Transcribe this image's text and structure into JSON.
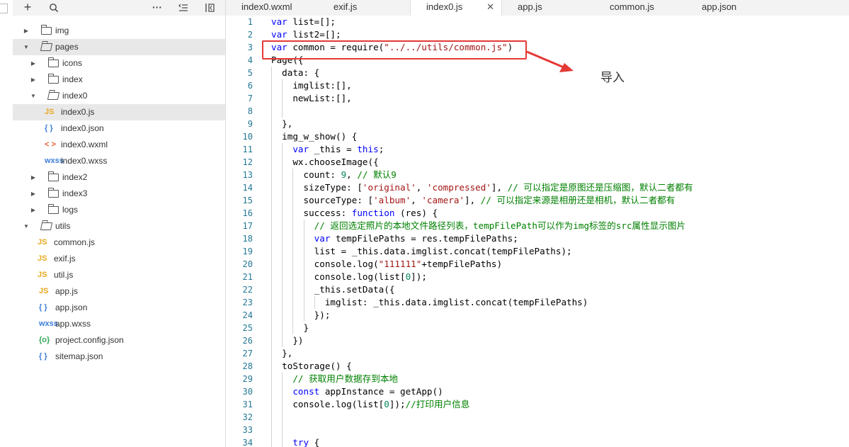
{
  "toolbar": {
    "icons": [
      "plus-icon",
      "search-icon",
      "more-icon",
      "collapse-icon",
      "split-icon"
    ]
  },
  "tabs": [
    {
      "label": "index0.wxml",
      "active": false
    },
    {
      "label": "exif.js",
      "active": false
    },
    {
      "label": "index0.js",
      "active": true
    },
    {
      "label": "app.js",
      "active": false
    },
    {
      "label": "common.js",
      "active": false
    },
    {
      "label": "app.json",
      "active": false
    }
  ],
  "tree": [
    {
      "label": "img",
      "type": "folder",
      "depth": 0,
      "expanded": false
    },
    {
      "label": "pages",
      "type": "folder",
      "depth": 0,
      "expanded": true,
      "hover": true
    },
    {
      "label": "icons",
      "type": "folder",
      "depth": 1,
      "expanded": false
    },
    {
      "label": "index",
      "type": "folder",
      "depth": 1,
      "expanded": false
    },
    {
      "label": "index0",
      "type": "folder",
      "depth": 1,
      "expanded": true
    },
    {
      "label": "index0.js",
      "type": "js",
      "depth": 2,
      "selected": true
    },
    {
      "label": "index0.json",
      "type": "json",
      "depth": 2
    },
    {
      "label": "index0.wxml",
      "type": "wxml",
      "depth": 2
    },
    {
      "label": "index0.wxss",
      "type": "wxss",
      "depth": 2
    },
    {
      "label": "index2",
      "type": "folder",
      "depth": 1,
      "expanded": false
    },
    {
      "label": "index3",
      "type": "folder",
      "depth": 1,
      "expanded": false
    },
    {
      "label": "logs",
      "type": "folder",
      "depth": 1,
      "expanded": false
    },
    {
      "label": "utils",
      "type": "folder",
      "depth": 0,
      "expanded": true
    },
    {
      "label": "common.js",
      "type": "js",
      "depth": 1
    },
    {
      "label": "exif.js",
      "type": "js",
      "depth": 1
    },
    {
      "label": "util.js",
      "type": "js",
      "depth": 1
    },
    {
      "label": "app.js",
      "type": "js",
      "depth": 0
    },
    {
      "label": "app.json",
      "type": "json",
      "depth": 0
    },
    {
      "label": "app.wxss",
      "type": "wxss",
      "depth": 0
    },
    {
      "label": "project.config.json",
      "type": "config",
      "depth": 0
    },
    {
      "label": "sitemap.json",
      "type": "json",
      "depth": 0
    }
  ],
  "icon_glyphs": {
    "js": "JS",
    "json": "{ }",
    "wxml": "< >",
    "wxss": "wxss",
    "config": "{o}"
  },
  "tab_close_glyph": "✕",
  "code": [
    {
      "n": "1",
      "indent": 0,
      "tokens": [
        [
          "k",
          "var"
        ],
        [
          "p",
          " list=[];"
        ]
      ]
    },
    {
      "n": "2",
      "indent": 0,
      "tokens": [
        [
          "k",
          "var"
        ],
        [
          "p",
          " list2=[];"
        ]
      ]
    },
    {
      "n": "3",
      "indent": 0,
      "tokens": [
        [
          "k",
          "var"
        ],
        [
          "p",
          " common = require("
        ],
        [
          "s",
          "\"../../utils/common.js\""
        ],
        [
          "p",
          ")"
        ]
      ]
    },
    {
      "n": "4",
      "indent": 0,
      "tokens": [
        [
          "p",
          "Page({"
        ]
      ]
    },
    {
      "n": "5",
      "indent": 1,
      "tokens": [
        [
          "p",
          "data: {"
        ]
      ]
    },
    {
      "n": "6",
      "indent": 2,
      "tokens": [
        [
          "p",
          "imglist:[],"
        ]
      ]
    },
    {
      "n": "7",
      "indent": 2,
      "tokens": [
        [
          "p",
          "newList:[],"
        ]
      ]
    },
    {
      "n": "8",
      "indent": 2,
      "tokens": []
    },
    {
      "n": "9",
      "indent": 1,
      "tokens": [
        [
          "p",
          "},"
        ]
      ]
    },
    {
      "n": "10",
      "indent": 1,
      "tokens": [
        [
          "p",
          "img_w_show() {"
        ]
      ]
    },
    {
      "n": "11",
      "indent": 2,
      "tokens": [
        [
          "k",
          "var"
        ],
        [
          "p",
          " _this = "
        ],
        [
          "k",
          "this"
        ],
        [
          "p",
          ";"
        ]
      ]
    },
    {
      "n": "12",
      "indent": 2,
      "tokens": [
        [
          "p",
          "wx.chooseImage({"
        ]
      ]
    },
    {
      "n": "13",
      "indent": 3,
      "tokens": [
        [
          "p",
          "count: "
        ],
        [
          "n",
          "9"
        ],
        [
          "p",
          ", "
        ],
        [
          "c",
          "// 默认9"
        ]
      ]
    },
    {
      "n": "14",
      "indent": 3,
      "tokens": [
        [
          "p",
          "sizeType: ["
        ],
        [
          "s",
          "'original'"
        ],
        [
          "p",
          ", "
        ],
        [
          "s",
          "'compressed'"
        ],
        [
          "p",
          "], "
        ],
        [
          "c",
          "// 可以指定是原图还是压缩图，默认二者都有"
        ]
      ]
    },
    {
      "n": "15",
      "indent": 3,
      "tokens": [
        [
          "p",
          "sourceType: ["
        ],
        [
          "s",
          "'album'"
        ],
        [
          "p",
          ", "
        ],
        [
          "s",
          "'camera'"
        ],
        [
          "p",
          "], "
        ],
        [
          "c",
          "// 可以指定来源是相册还是相机，默认二者都有"
        ]
      ]
    },
    {
      "n": "16",
      "indent": 3,
      "tokens": [
        [
          "p",
          "success: "
        ],
        [
          "k",
          "function"
        ],
        [
          "p",
          " (res) {"
        ]
      ]
    },
    {
      "n": "17",
      "indent": 4,
      "tokens": [
        [
          "c",
          "// 返回选定照片的本地文件路径列表，tempFilePath可以作为img标签的src属性显示图片"
        ]
      ]
    },
    {
      "n": "18",
      "indent": 4,
      "tokens": [
        [
          "k",
          "var"
        ],
        [
          "p",
          " tempFilePaths = res.tempFilePaths;"
        ]
      ]
    },
    {
      "n": "19",
      "indent": 4,
      "tokens": [
        [
          "p",
          "list = _this.data.imglist.concat(tempFilePaths);"
        ]
      ]
    },
    {
      "n": "20",
      "indent": 4,
      "tokens": [
        [
          "p",
          "console.log("
        ],
        [
          "s",
          "\"111111\""
        ],
        [
          "p",
          "+tempFilePaths)"
        ]
      ]
    },
    {
      "n": "21",
      "indent": 4,
      "tokens": [
        [
          "p",
          "console.log(list["
        ],
        [
          "n",
          "0"
        ],
        [
          "p",
          "]);"
        ]
      ]
    },
    {
      "n": "22",
      "indent": 4,
      "tokens": [
        [
          "p",
          "_this.setData({"
        ]
      ]
    },
    {
      "n": "23",
      "indent": 5,
      "tokens": [
        [
          "p",
          "imglist: _this.data.imglist.concat(tempFilePaths)"
        ]
      ]
    },
    {
      "n": "24",
      "indent": 4,
      "tokens": [
        [
          "p",
          "});"
        ]
      ]
    },
    {
      "n": "25",
      "indent": 3,
      "tokens": [
        [
          "p",
          "}"
        ]
      ]
    },
    {
      "n": "26",
      "indent": 2,
      "tokens": [
        [
          "p",
          "})"
        ]
      ]
    },
    {
      "n": "27",
      "indent": 1,
      "tokens": [
        [
          "p",
          "},"
        ]
      ]
    },
    {
      "n": "28",
      "indent": 1,
      "tokens": [
        [
          "p",
          "toStorage() {"
        ]
      ]
    },
    {
      "n": "29",
      "indent": 2,
      "tokens": [
        [
          "c",
          "// 获取用户数据存到本地"
        ]
      ]
    },
    {
      "n": "30",
      "indent": 2,
      "tokens": [
        [
          "k",
          "const"
        ],
        [
          "p",
          " appInstance = getApp()"
        ]
      ]
    },
    {
      "n": "31",
      "indent": 2,
      "tokens": [
        [
          "p",
          "console.log(list["
        ],
        [
          "n",
          "0"
        ],
        [
          "p",
          "]);"
        ],
        [
          "c",
          "//打印用户信息"
        ]
      ]
    },
    {
      "n": "32",
      "indent": 2,
      "tokens": []
    },
    {
      "n": "33",
      "indent": 2,
      "tokens": []
    },
    {
      "n": "34",
      "indent": 2,
      "tokens": [
        [
          "k",
          "try"
        ],
        [
          "p",
          " {"
        ]
      ]
    }
  ],
  "annotation": {
    "text": "导入"
  },
  "colors": {
    "keyword": "#0000ff",
    "string": "#a31515",
    "comment": "#008000",
    "number": "#098658",
    "plain": "#000000",
    "highlight": "#e53935"
  }
}
